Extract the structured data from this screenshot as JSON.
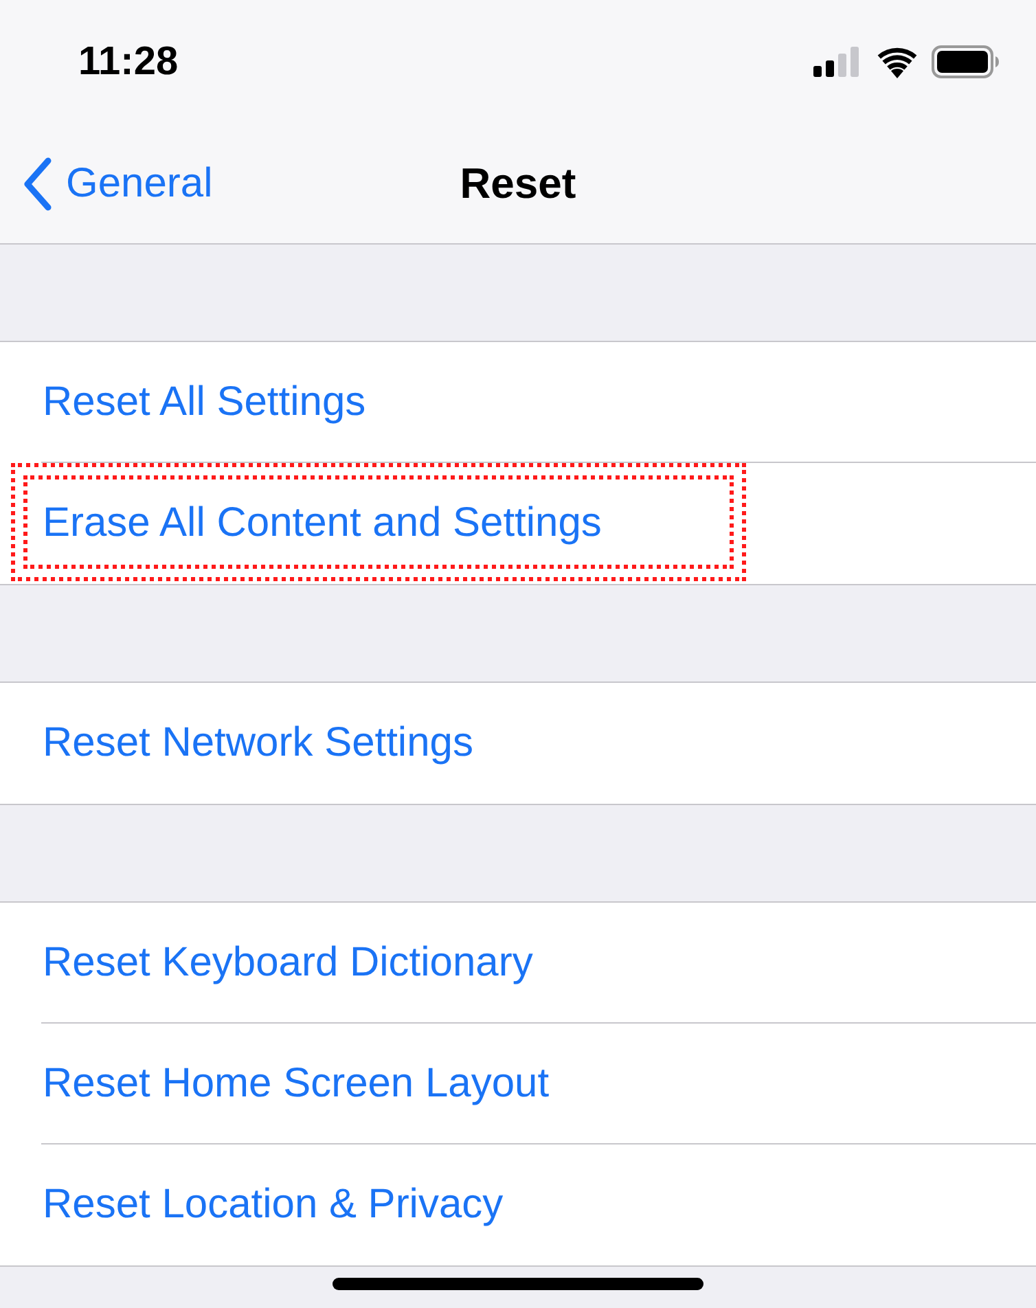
{
  "status_bar": {
    "time": "11:28"
  },
  "nav": {
    "back_label": "General",
    "title": "Reset"
  },
  "groups": [
    {
      "items": [
        {
          "label": "Reset All Settings",
          "highlighted": false
        },
        {
          "label": "Erase All Content and Settings",
          "highlighted": true
        }
      ]
    },
    {
      "items": [
        {
          "label": "Reset Network Settings",
          "highlighted": false
        }
      ]
    },
    {
      "items": [
        {
          "label": "Reset Keyboard Dictionary",
          "highlighted": false
        },
        {
          "label": "Reset Home Screen Layout",
          "highlighted": false
        },
        {
          "label": "Reset Location & Privacy",
          "highlighted": false
        }
      ]
    }
  ]
}
